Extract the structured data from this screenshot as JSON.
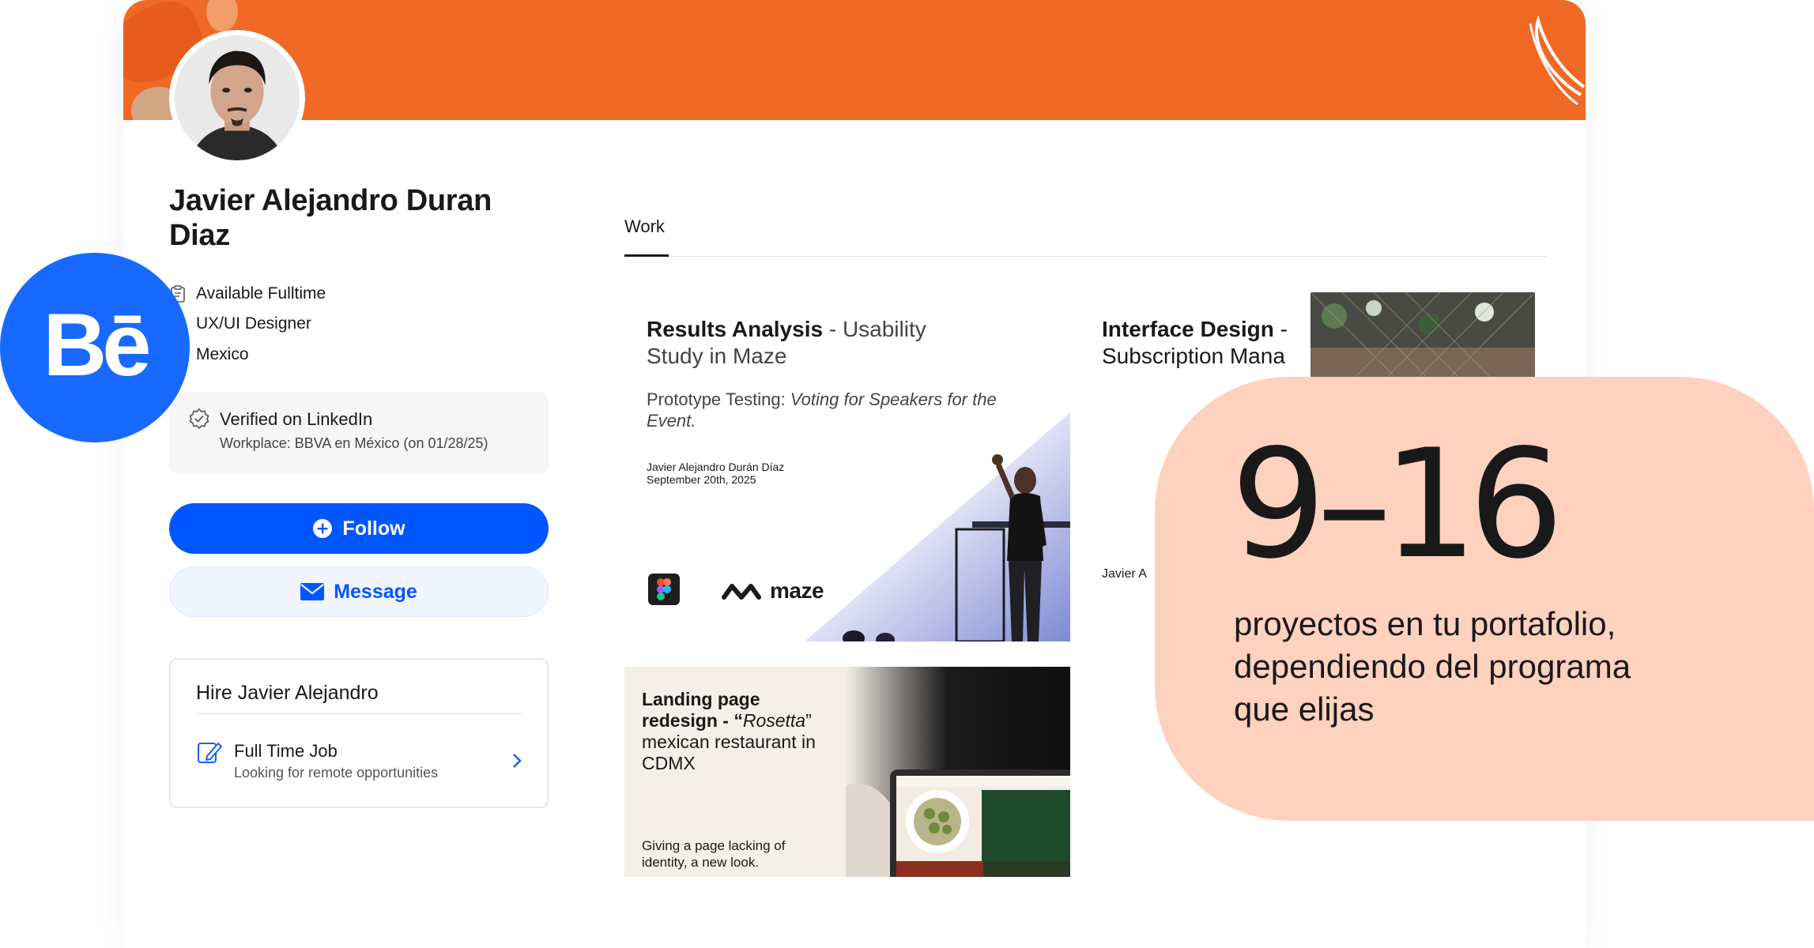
{
  "profile": {
    "name": "Javier Alejandro Duran Diaz",
    "availability": "Available Fulltime",
    "role": "UX/UI Designer",
    "location": "Mexico",
    "verified": {
      "title": "Verified on LinkedIn",
      "workplace": "Workplace: BBVA en México (on 01/28/25)"
    },
    "follow_label": "Follow",
    "message_label": "Message",
    "hire": {
      "title": "Hire Javier Alejandro",
      "job_title": "Full Time Job",
      "job_sub": "Looking for remote opportunities"
    }
  },
  "tabs": [
    {
      "label": "Work",
      "active": true
    }
  ],
  "projects": [
    {
      "title_bold": "Results Analysis",
      "title_rest": " - Usability Study in Maze",
      "desc_plain": "Prototype Testing: ",
      "desc_italic": "Voting for Speakers for the Event.",
      "author": "Javier Alejandro Durán Díaz",
      "date": "September 20th, 2025",
      "brand": "maze"
    },
    {
      "title_bold": "Landing page redesign",
      "title_mid": " - “",
      "title_italic": "Rosetta",
      "title_end": "” mexican restaurant in CDMX",
      "sub": "Giving a page lacking of identity, a new look."
    },
    {
      "title_bold": "Interface Design",
      "title_rest": " - Subscription Mana",
      "author": "Javier A"
    }
  ],
  "callout": {
    "big": "9–16",
    "caption": "proyectos en tu portafolio, dependiendo del programa que elijas"
  },
  "badge": {
    "text": "Bē"
  },
  "colors": {
    "cover": "#f06a25",
    "primary": "#0057ff",
    "behance": "#1769ff",
    "callout": "#fed2bf"
  }
}
